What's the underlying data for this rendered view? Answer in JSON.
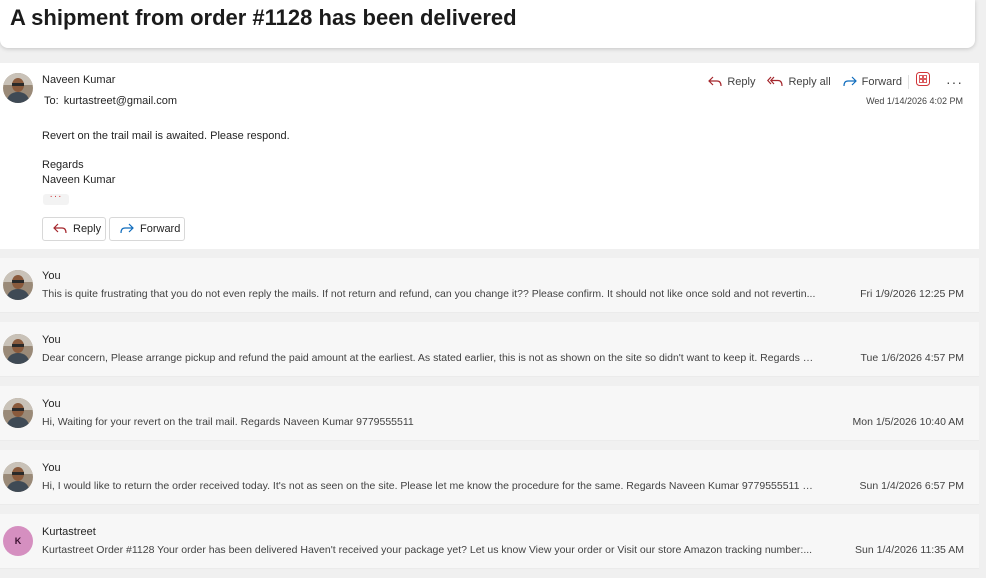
{
  "subject": "A shipment from order #1128 has been delivered",
  "open_message": {
    "sender": "Naveen Kumar",
    "to_label": "To:",
    "to_address": "kurtastreet@gmail.com",
    "date": "Wed 1/14/2026 4:02 PM",
    "actions": {
      "reply": "Reply",
      "reply_all": "Reply all",
      "forward": "Forward"
    },
    "body": [
      "Revert on the trail mail is awaited. Please respond.",
      "Regards",
      "Naveen Kumar"
    ],
    "ellipsis": "···",
    "buttons": {
      "reply": "Reply",
      "forward": "Forward"
    }
  },
  "thread": [
    {
      "sender": "You",
      "preview": "This is quite frustrating that you do not even reply the mails. If not return and refund, can you change it?? Please confirm. It should not like once sold and not revertin...",
      "date": "Fri 1/9/2026 12:25 PM"
    },
    {
      "sender": "You",
      "preview": "Dear concern, Please arrange pickup and refund the paid amount at the earliest. As stated earlier, this is not as shown on the site so didn't want to keep it. Regards N...",
      "date": "Tue 1/6/2026 4:57 PM"
    },
    {
      "sender": "You",
      "preview": "Hi, Waiting for your revert on the trail mail. Regards Naveen Kumar 9779555511",
      "date": "Mon 1/5/2026 10:40 AM"
    },
    {
      "sender": "You",
      "preview": "Hi, I would like to return the order received today. It's not as seen on the site. Please let me know the procedure for the same. Regards Naveen Kumar 9779555511 Se...",
      "date": "Sun 1/4/2026 6:57 PM"
    },
    {
      "sender": "Kurtastreet",
      "initial": "K",
      "preview": "Kurtastreet Order #1128 Your order has been delivered Haven't received your package yet? Let us know View your order or Visit our store Amazon tracking number:...",
      "date": "Sun 1/4/2026 11:35 AM"
    }
  ],
  "colors": {
    "reply_icon": "#a4262c",
    "forward_icon": "#0f6cbd",
    "letter_avatar": "#d58fc0"
  }
}
